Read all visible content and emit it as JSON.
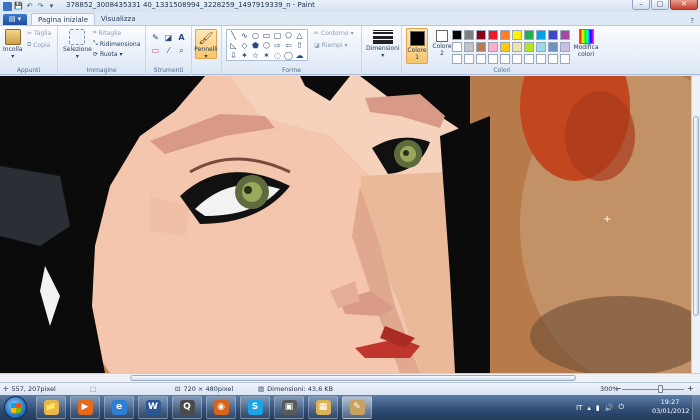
{
  "window": {
    "title": "378852_3008435331 40_1331508994_3228259_1497919339_n - Paint",
    "controls": {
      "minimize": "–",
      "maximize": "□",
      "close": "✕"
    }
  },
  "qat": {
    "save": "💾",
    "undo": "↶",
    "redo": "↷"
  },
  "ribbon": {
    "app_menu": "▤ ▾",
    "tabs": [
      {
        "label": "Pagina iniziale",
        "active": true
      },
      {
        "label": "Visualizza",
        "active": false
      }
    ],
    "groups": {
      "appunti": {
        "label": "Appunti",
        "paste": "Incolla",
        "cut": "Taglia",
        "copy": "Copia"
      },
      "immagine": {
        "label": "Immagine",
        "select": "Selezione",
        "crop": "Ritaglia",
        "resize": "Ridimensiona",
        "rotate": "Ruota"
      },
      "strumenti": {
        "label": "Strumenti"
      },
      "pennelli": {
        "label": "Pennelli"
      },
      "forme": {
        "label": "Forme",
        "outline": "Contorno",
        "fill": "Riempi"
      },
      "dimensioni": {
        "label": "Dimensioni"
      },
      "colori": {
        "label": "Colori",
        "color1": "Colore 1",
        "color2": "Colore 2",
        "edit": "Modifica colori",
        "color1_value": "#000000",
        "color2_value": "#ffffff",
        "palette": [
          "#000000",
          "#7f7f7f",
          "#880015",
          "#ed1c24",
          "#ff7f27",
          "#fff200",
          "#22b14c",
          "#00a2e8",
          "#3f48cc",
          "#a349a4",
          "#ffffff",
          "#c3c3c3",
          "#b97a57",
          "#ffaec9",
          "#ffc90e",
          "#efe4b0",
          "#b5e61d",
          "#99d9ea",
          "#7092be",
          "#c8bfe7",
          "#ffffff",
          "#ffffff",
          "#ffffff",
          "#ffffff",
          "#ffffff",
          "#ffffff",
          "#ffffff",
          "#ffffff",
          "#ffffff",
          "#ffffff"
        ]
      }
    }
  },
  "status": {
    "cursor_pos": "557, 207pixel",
    "image_size": "720 × 480pixel",
    "file_size": "Dimensioni: 43,6 KB",
    "zoom": "300%"
  },
  "taskbar": {
    "apps": [
      {
        "name": "explorer",
        "glyph": "📁",
        "color": "#e8b84a"
      },
      {
        "name": "media-player",
        "glyph": "▶",
        "color": "#e56a1b"
      },
      {
        "name": "internet-explorer",
        "glyph": "e",
        "color": "#2d7fd3"
      },
      {
        "name": "word",
        "glyph": "W",
        "color": "#2b5797"
      },
      {
        "name": "quicktime",
        "glyph": "Q",
        "color": "#4a4a4a"
      },
      {
        "name": "firefox",
        "glyph": "◉",
        "color": "#d8631b"
      },
      {
        "name": "skype",
        "glyph": "S",
        "color": "#1aa5e8"
      },
      {
        "name": "media-center",
        "glyph": "▣",
        "color": "#5a5a5a"
      },
      {
        "name": "folder",
        "glyph": "▦",
        "color": "#d9b456"
      },
      {
        "name": "paint",
        "glyph": "✎",
        "color": "#c8a25e"
      }
    ],
    "language": "IT",
    "clock_time": "19:27",
    "clock_date": "03/01/2012"
  }
}
